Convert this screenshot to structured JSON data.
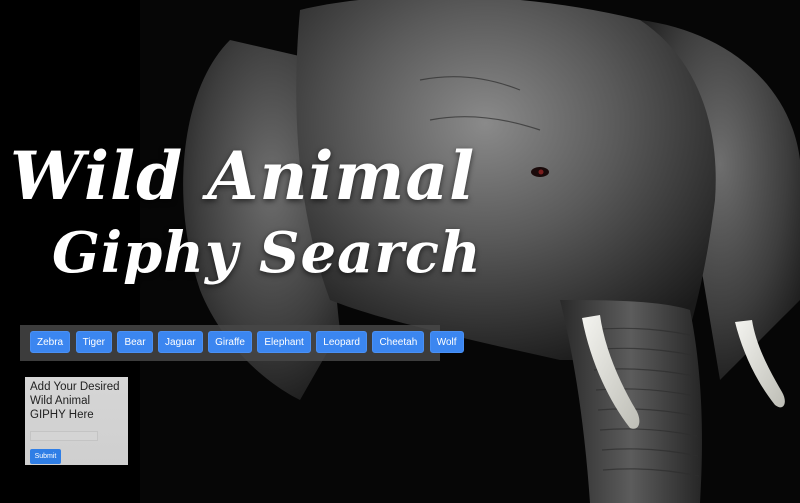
{
  "hero": {
    "line1": "Wild Animal",
    "line2": "Giphy Search"
  },
  "buttons": [
    "Zebra",
    "Tiger",
    "Bear",
    "Jaguar",
    "Giraffe",
    "Elephant",
    "Leopard",
    "Cheetah",
    "Wolf"
  ],
  "form": {
    "label": "Add Your Desired Wild Animal GIPHY Here",
    "input_value": "",
    "submit_label": "Submit"
  },
  "colors": {
    "background": "#000000",
    "button_blue": "#3b86f0",
    "button_bar": "#464646",
    "form_panel": "#d3d3d3"
  }
}
